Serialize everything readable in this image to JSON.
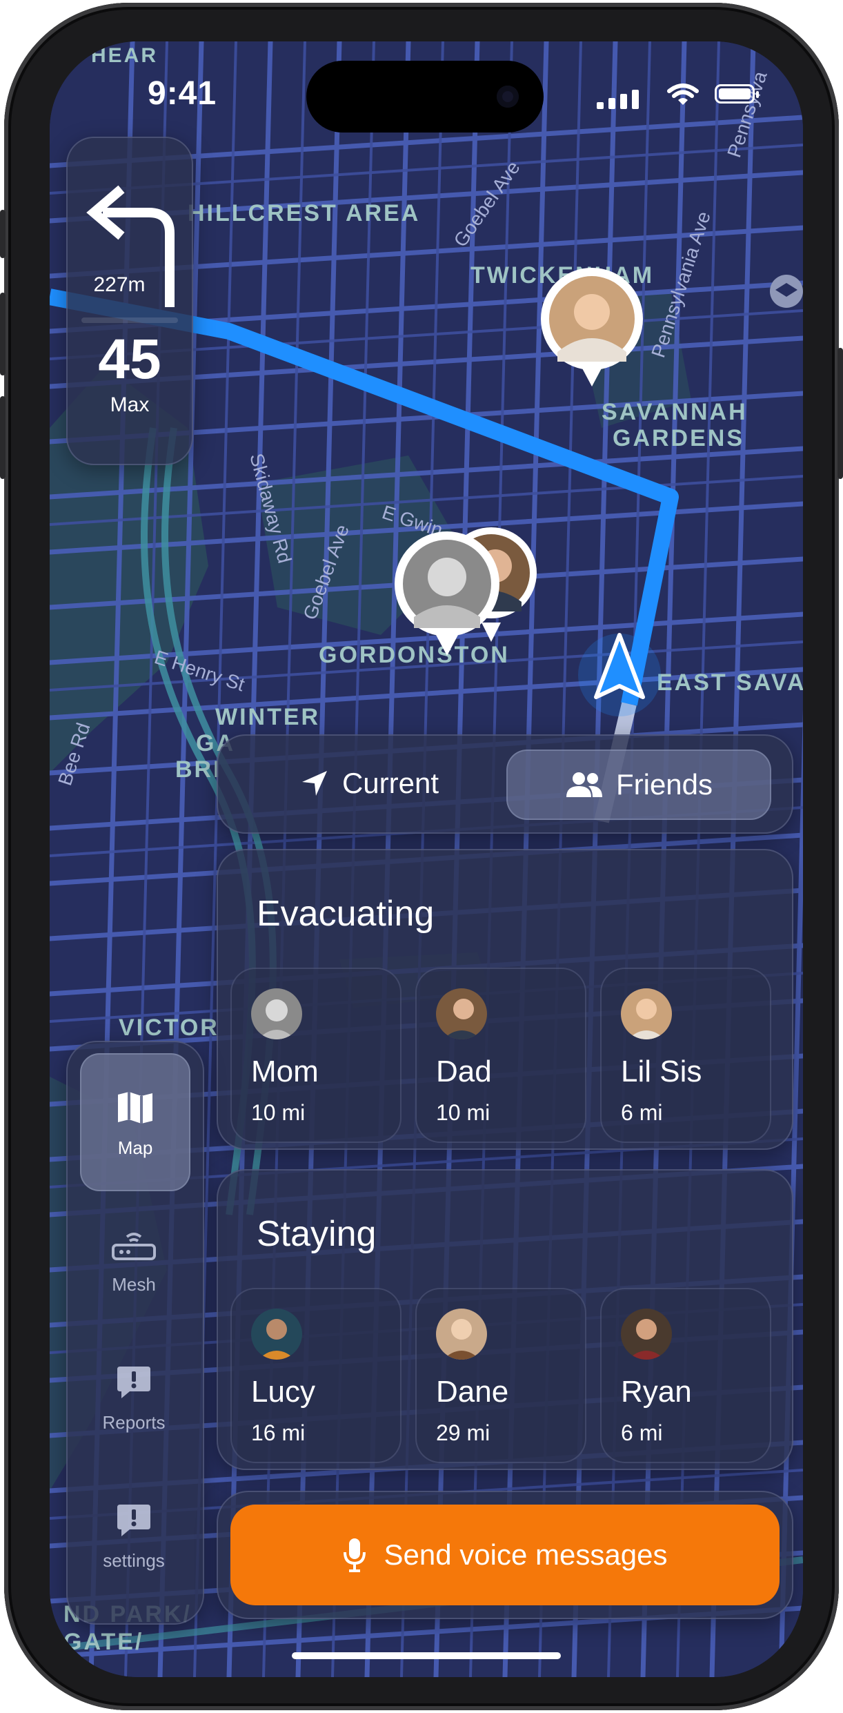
{
  "status_bar": {
    "time": "9:41"
  },
  "navigation": {
    "distance": "227m",
    "speed_limit": "45",
    "speed_label": "Max"
  },
  "map_labels": {
    "area1": "HILLCREST AREA",
    "area2": "TWICKENHAM",
    "area3a": "SAVANNAH",
    "area3b": "GARDENS",
    "area4": "GORDONSTON",
    "area5": "EAST SAVA",
    "area6a": "WINTER",
    "area6b": "GA",
    "area6c": "BRI",
    "area7": "VICTOR",
    "area8a": "ND PARK/",
    "area8b": "GATE/",
    "area9": "HEAR",
    "st1": "Goebel Ave",
    "st2": "Pennsylvania Ave",
    "st3": "Skidaway Rd",
    "st4": "Goebel Ave",
    "st5": "E Gwin",
    "st6": "E Henry St",
    "st7": "Bee Rd",
    "st8": "Pennsylva"
  },
  "segmented": {
    "current_label": "Current",
    "friends_label": "Friends",
    "selected": "Friends"
  },
  "groups": [
    {
      "title": "Evacuating",
      "friends": [
        {
          "name": "Mom",
          "distance": "10 mi"
        },
        {
          "name": "Dad",
          "distance": "10 mi"
        },
        {
          "name": "Lil Sis",
          "distance": "6 mi"
        }
      ]
    },
    {
      "title": "Staying",
      "friends": [
        {
          "name": "Lucy",
          "distance": "16 mi"
        },
        {
          "name": "Dane",
          "distance": "29 mi"
        },
        {
          "name": "Ryan",
          "distance": "6 mi"
        }
      ]
    }
  ],
  "sidebar": {
    "items": [
      {
        "label": "Map",
        "icon": "map-icon",
        "active": true
      },
      {
        "label": "Mesh",
        "icon": "router-icon",
        "active": false
      },
      {
        "label": "Reports",
        "icon": "report-icon",
        "active": false
      },
      {
        "label": "settings",
        "icon": "report-icon",
        "active": false
      }
    ]
  },
  "voice_button": {
    "label": "Send voice messages"
  },
  "colors": {
    "accent": "#f5780a",
    "route": "#1f8fff",
    "map_bg": "#262e5e"
  }
}
